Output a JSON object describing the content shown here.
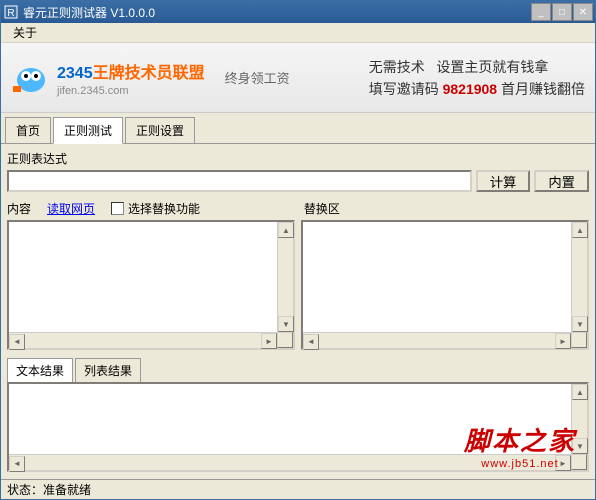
{
  "window": {
    "title": "睿元正则测试器 V1.0.0.0"
  },
  "menu": {
    "about": "关于"
  },
  "banner": {
    "logo_prefix": "2345",
    "logo_text": "王牌技术员联盟",
    "logo_sub": "jifen.2345.com",
    "mid_text": "终身领工资",
    "right_line1a": "无需技术",
    "right_line1b": "设置主页就有钱拿",
    "right_line2a": "填写邀请码",
    "right_line2_code": "9821908",
    "right_line2b": "首月赚钱翻倍"
  },
  "tabs": {
    "home": "首页",
    "test": "正则测试",
    "settings": "正则设置"
  },
  "labels": {
    "expression": "正则表达式",
    "content": "内容",
    "get_page": "读取网页",
    "replace_func": "选择替换功能",
    "replace_area": "替换区",
    "text_result": "文本结果",
    "list_result": "列表结果"
  },
  "buttons": {
    "calc": "计算",
    "builtin": "内置"
  },
  "status": {
    "label": "状态：",
    "value": "准备就绪"
  },
  "watermark": {
    "main": "脚本之家",
    "sub": "www.jb51.net"
  }
}
